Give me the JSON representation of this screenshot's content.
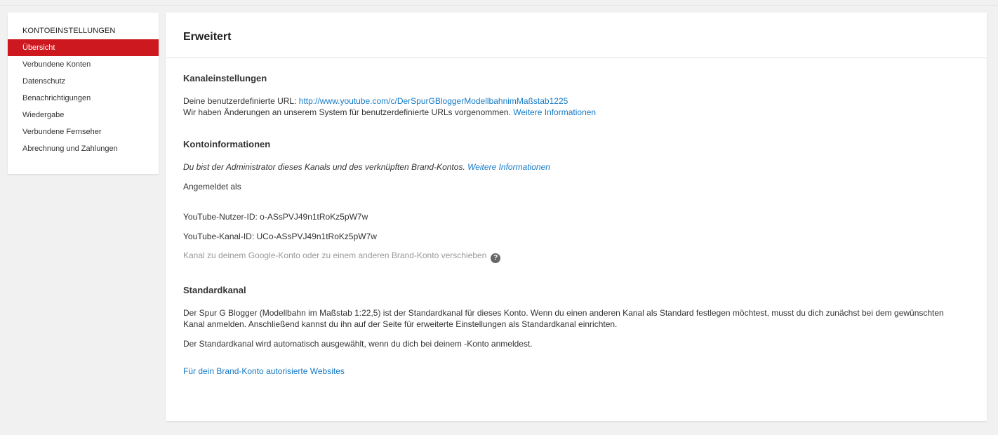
{
  "sidebar": {
    "header": "KONTOEINSTELLUNGEN",
    "items": [
      {
        "label": "Übersicht"
      },
      {
        "label": "Verbundene Konten"
      },
      {
        "label": "Datenschutz"
      },
      {
        "label": "Benachrichtigungen"
      },
      {
        "label": "Wiedergabe"
      },
      {
        "label": "Verbundene Fernseher"
      },
      {
        "label": "Abrechnung und Zahlungen"
      }
    ]
  },
  "main": {
    "title": "Erweitert",
    "channel_settings": {
      "heading": "Kanaleinstellungen",
      "custom_url_label": "Deine benutzerdefinierte URL: ",
      "custom_url": "http://www.youtube.com/c/DerSpurGBloggerModellbahnimMaßstab1225",
      "changes_text": "Wir haben Änderungen an unserem System für benutzerdefinierte URLs vorgenommen. ",
      "more_info_link": "Weitere Informationen"
    },
    "account_info": {
      "heading": "Kontoinformationen",
      "admin_text": "Du bist der Administrator dieses Kanals und des verknüpften Brand-Kontos. ",
      "more_info_link": "Weitere Informationen",
      "signed_in_as": "Angemeldet als",
      "user_id": "YouTube-Nutzer-ID: o-ASsPVJ49n1tRoKz5pW7w",
      "channel_id": "YouTube-Kanal-ID: UCo-ASsPVJ49n1tRoKz5pW7w",
      "move_channel_text": "Kanal zu deinem Google-Konto oder zu einem anderen Brand-Konto verschieben",
      "help_glyph": "?"
    },
    "default_channel": {
      "heading": "Standardkanal",
      "paragraph1": "Der Spur G Blogger (Modellbahn im Maßstab 1:22,5) ist der Standardkanal für dieses Konto. Wenn du einen anderen Kanal als Standard festlegen möchtest, musst du dich zunächst bei dem gewünschten Kanal anmelden. Anschließend kannst du ihn auf der Seite für erweiterte Einstellungen als Standardkanal einrichten.",
      "paragraph2": "Der Standardkanal wird automatisch ausgewählt, wenn du dich bei deinem -Konto anmeldest.",
      "authorized_sites_link": "Für dein Brand-Konto autorisierte Websites"
    }
  }
}
